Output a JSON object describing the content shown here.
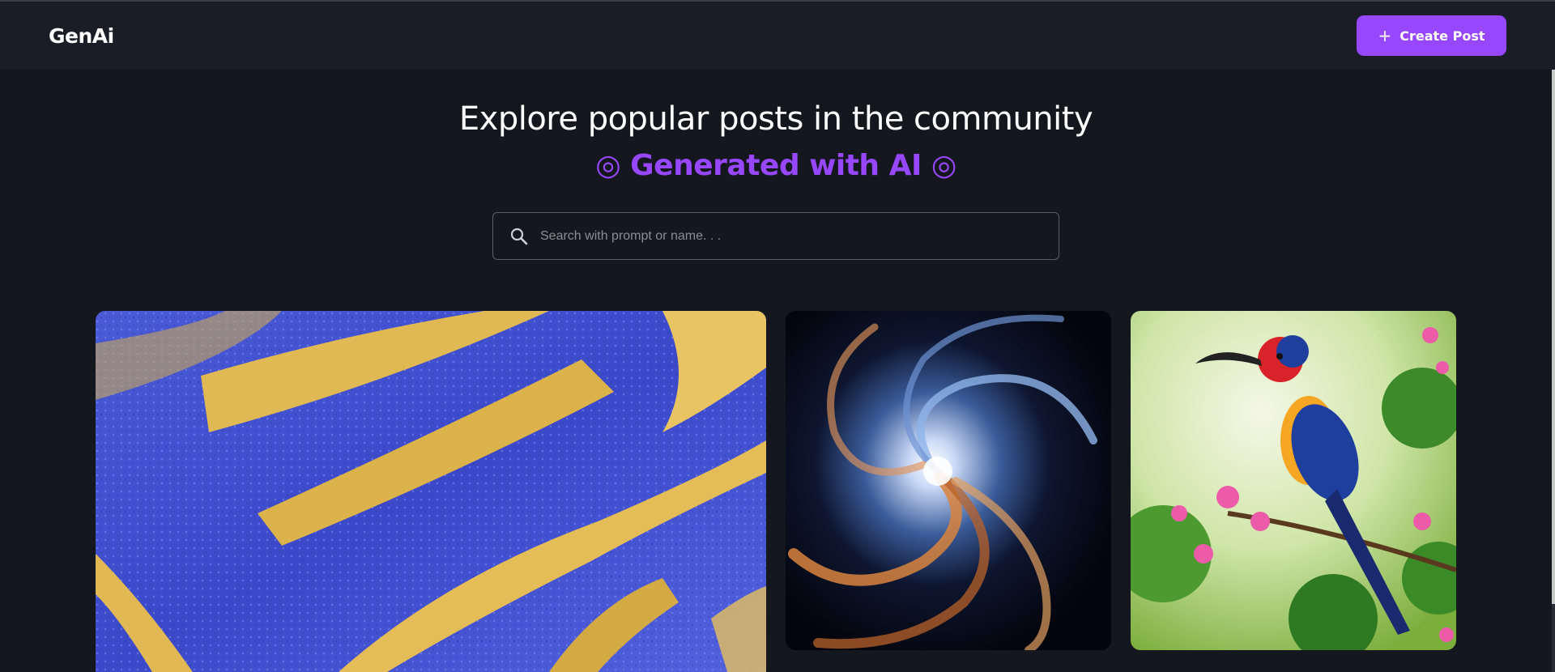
{
  "navbar": {
    "logo": "GenAi",
    "create_button_label": "Create Post"
  },
  "hero": {
    "title": "Explore popular posts in the community",
    "subtitle": "◎ Generated with AI ◎"
  },
  "search": {
    "placeholder": "Search with prompt or name. . ."
  },
  "posts": [
    {
      "image": "blue-gold-marble-art"
    },
    {
      "image": "cosmic-spiral-galaxy"
    },
    {
      "image": "colorful-bird-on-flowers"
    }
  ],
  "colors": {
    "accent": "#9747ff",
    "background": "#15171e",
    "navbar": "#1b1d26"
  }
}
